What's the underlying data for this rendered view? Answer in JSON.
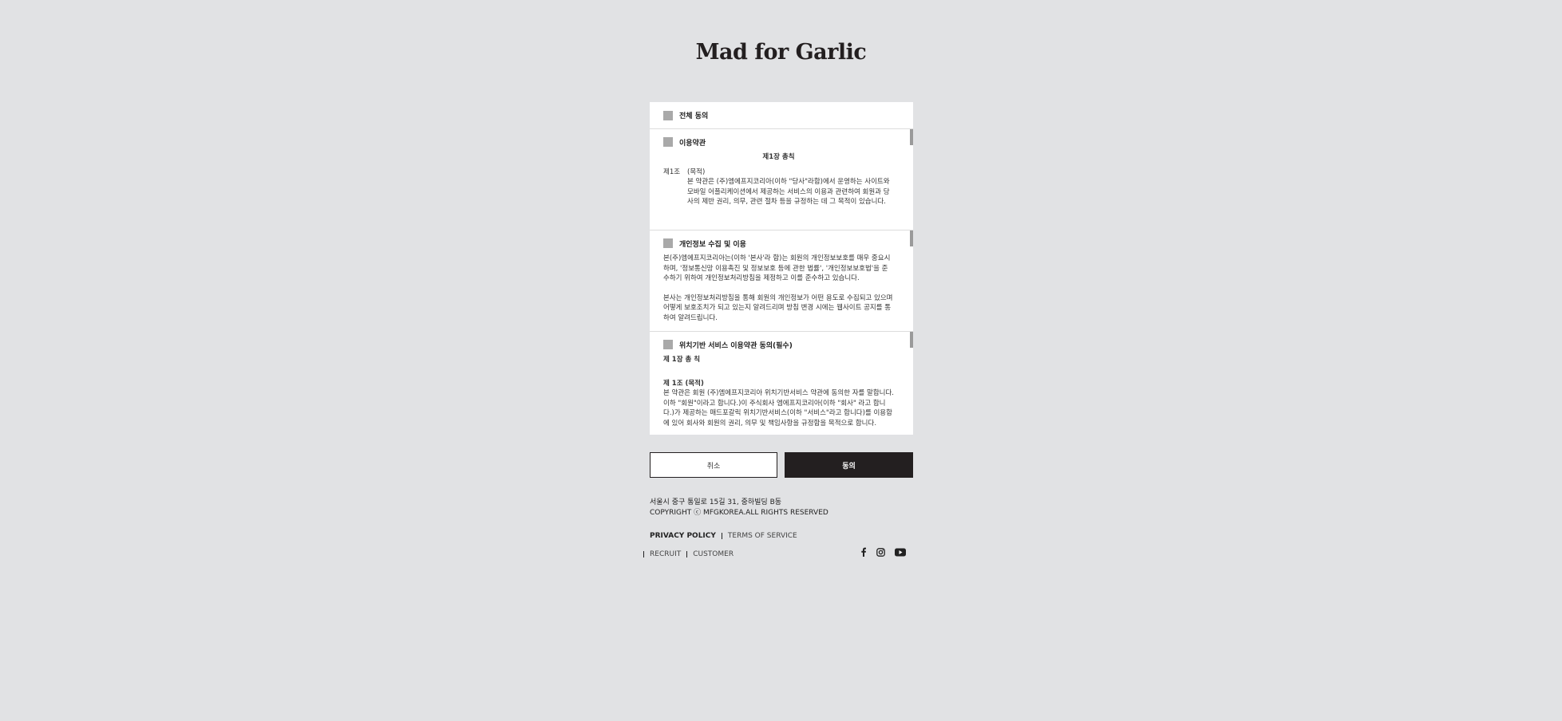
{
  "brand": {
    "logo_text": "Mad for Garlic"
  },
  "consent": {
    "agree_all_label": "전체 동의",
    "terms": {
      "title": "이용약관",
      "chapter": "제1장 총칙",
      "article_num": "제1조",
      "article_title": "(목적)",
      "body": "본 약관은 (주)엠에프지코리아(이하 \"당사\"라함)에서 운영하는 사이트와 모바일 어플리케이션에서 제공하는 서비스의 이용과 관련하여 회원과 당사의 제반 권리, 의무, 관련 절차 등을 규정하는 데 그 목적이 있습니다."
    },
    "privacy": {
      "title": "개인정보 수집 및 이용",
      "para1": "본(주)엠에프지코리아는(이하 '본사'라 함)는 회원의 개인정보보호를 매우 중요시하며, '정보통신망 이용촉진 및 정보보호 등에 관한 법률', '개인정보보호법'을 준수하기 위하여 개인정보처리방침을 제정하고 이를 준수하고 있습니다.",
      "para2": "본사는 개인정보처리방침을 통해 회원의 개인정보가 어떤 용도로 수집되고 있으며 어떻게 보호조치가 되고 있는지 알려드리며 방침 변경 시에는 웹사이트 공지를 통하여 알려드립니다."
    },
    "location": {
      "title": "위치기반 서비스 이용약관 동의(필수)",
      "chapter": "제 1장 총 칙",
      "article": "제 1조 (목적)",
      "body": "본 약관은 회원 (주)엠에프지코리아 위치기반서비스 약관에 동의한 자를 말합니다. 이하 \"회원\"이라고 합니다.)이 주식회사 엠에프지코리아(이하 \"회사\" 라고 합니다.)가 제공하는 매드포갈릭 위치기반서비스(이하 \"서비스\"라고 합니다)를 이용함에 있어 회사와 회원의 권리, 의무 및 책임사항을 규정함을 목적으로 합니다."
    }
  },
  "buttons": {
    "cancel": "취소",
    "agree": "동의"
  },
  "footer": {
    "address": "서울시 중구 통일로 15길 31, 중하빌딩 B동",
    "copyright": "COPYRIGHT ⓒ MFGKOREA.ALL RIGHTS RESERVED",
    "privacy_policy": "PRIVACY POLICY",
    "terms_of_service": "TERMS OF SERVICE",
    "recruit": "RECRUIT",
    "customer": "CUSTOMER"
  },
  "social": {
    "facebook": "facebook-icon",
    "instagram": "instagram-icon",
    "youtube": "youtube-icon"
  }
}
